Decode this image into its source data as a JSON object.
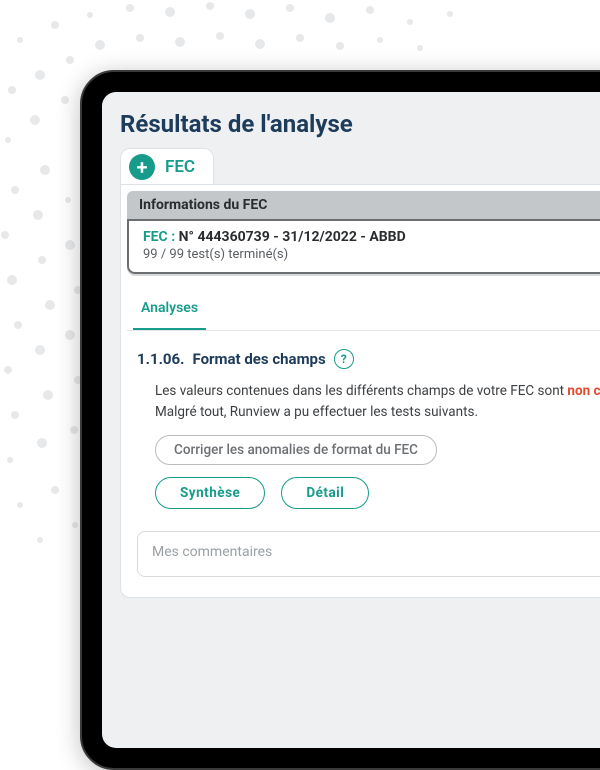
{
  "page": {
    "title": "Résultats de l'analyse"
  },
  "fec_chip": {
    "label": "FEC",
    "plus_icon": "plus-icon"
  },
  "info": {
    "header": "Informations du FEC",
    "label": "FEC :",
    "value": "N° 444360739 - 31/12/2022 - ABBD",
    "tests_status": "99 / 99 test(s) terminé(s)"
  },
  "tabs": {
    "active": "Analyses"
  },
  "section": {
    "number": "1.1.06.",
    "title": "Format des champs",
    "help_icon": "?",
    "body_prefix": "Les valeurs contenues dans les différents champs de votre FEC sont ",
    "non_conformes": "non conformes",
    "body_line2": "Malgré tout, Runview a pu effectuer les tests suivants.",
    "fix_button": "Corriger les anomalies de format du FEC",
    "synthese": "Synthèse",
    "detail": "Détail"
  },
  "comments": {
    "placeholder": "Mes commentaires"
  },
  "colors": {
    "teal": "#179b8a",
    "navy": "#1d3b5a",
    "error": "#e34b2f"
  }
}
